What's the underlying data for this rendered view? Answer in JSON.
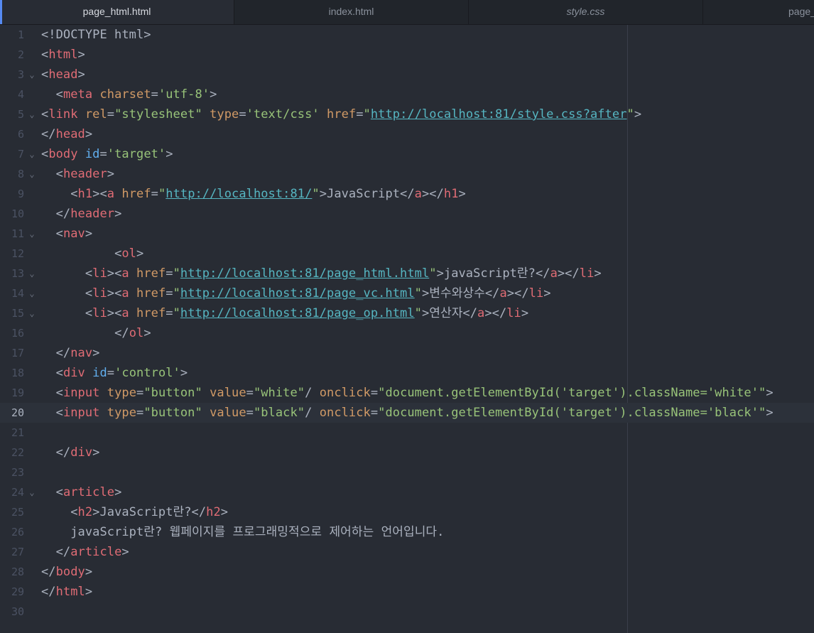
{
  "tabs": [
    {
      "label": "page_html.html",
      "active": true
    },
    {
      "label": "index.html",
      "active": false
    },
    {
      "label": "style.css",
      "active": false
    },
    {
      "label": "page_",
      "active": false
    }
  ],
  "cursor_line": 20,
  "lines": [
    {
      "n": "1",
      "fold": false,
      "tokens": [
        [
          "p",
          "<!DOCTYPE html>"
        ]
      ]
    },
    {
      "n": "2",
      "fold": false,
      "tokens": [
        [
          "p",
          "<"
        ],
        [
          "t",
          "html"
        ],
        [
          "p",
          ">"
        ]
      ]
    },
    {
      "n": "3",
      "fold": true,
      "tokens": [
        [
          "p",
          "<"
        ],
        [
          "t",
          "head"
        ],
        [
          "p",
          ">"
        ]
      ]
    },
    {
      "n": "4",
      "fold": false,
      "tokens": [
        [
          "x",
          "  "
        ],
        [
          "p",
          "<"
        ],
        [
          "t",
          "meta"
        ],
        [
          "x",
          " "
        ],
        [
          "a",
          "charset"
        ],
        [
          "p",
          "="
        ],
        [
          "s",
          "'utf-8'"
        ],
        [
          "p",
          ">"
        ]
      ]
    },
    {
      "n": "5",
      "fold": true,
      "tokens": [
        [
          "p",
          "<"
        ],
        [
          "t",
          "link"
        ],
        [
          "x",
          " "
        ],
        [
          "a",
          "rel"
        ],
        [
          "p",
          "="
        ],
        [
          "s",
          "\"stylesheet\""
        ],
        [
          "x",
          " "
        ],
        [
          "a",
          "type"
        ],
        [
          "p",
          "="
        ],
        [
          "s",
          "'text/css'"
        ],
        [
          "x",
          " "
        ],
        [
          "a",
          "href"
        ],
        [
          "p",
          "="
        ],
        [
          "s",
          "\""
        ],
        [
          "u",
          "http://localhost:81/style.css?after"
        ],
        [
          "s",
          "\""
        ],
        [
          "p",
          ">"
        ]
      ]
    },
    {
      "n": "6",
      "fold": false,
      "tokens": [
        [
          "p",
          "</"
        ],
        [
          "t",
          "head"
        ],
        [
          "p",
          ">"
        ]
      ]
    },
    {
      "n": "7",
      "fold": true,
      "tokens": [
        [
          "p",
          "<"
        ],
        [
          "t",
          "body"
        ],
        [
          "x",
          " "
        ],
        [
          "i",
          "id"
        ],
        [
          "p",
          "="
        ],
        [
          "s",
          "'target'"
        ],
        [
          "p",
          ">"
        ]
      ]
    },
    {
      "n": "8",
      "fold": true,
      "tokens": [
        [
          "x",
          "  "
        ],
        [
          "p",
          "<"
        ],
        [
          "t",
          "header"
        ],
        [
          "p",
          ">"
        ]
      ]
    },
    {
      "n": "9",
      "fold": false,
      "tokens": [
        [
          "x",
          "    "
        ],
        [
          "p",
          "<"
        ],
        [
          "t",
          "h1"
        ],
        [
          "p",
          "><"
        ],
        [
          "t",
          "a"
        ],
        [
          "x",
          " "
        ],
        [
          "a",
          "href"
        ],
        [
          "p",
          "="
        ],
        [
          "s",
          "\""
        ],
        [
          "u",
          "http://localhost:81/"
        ],
        [
          "s",
          "\""
        ],
        [
          "p",
          ">JavaScript</"
        ],
        [
          "t",
          "a"
        ],
        [
          "p",
          "></"
        ],
        [
          "t",
          "h1"
        ],
        [
          "p",
          ">"
        ]
      ]
    },
    {
      "n": "10",
      "fold": false,
      "tokens": [
        [
          "x",
          "  "
        ],
        [
          "p",
          "</"
        ],
        [
          "t",
          "header"
        ],
        [
          "p",
          ">"
        ]
      ]
    },
    {
      "n": "11",
      "fold": true,
      "tokens": [
        [
          "x",
          "  "
        ],
        [
          "p",
          "<"
        ],
        [
          "t",
          "nav"
        ],
        [
          "p",
          ">"
        ]
      ]
    },
    {
      "n": "12",
      "fold": false,
      "tokens": [
        [
          "x",
          "          "
        ],
        [
          "p",
          "<"
        ],
        [
          "t",
          "ol"
        ],
        [
          "p",
          ">"
        ]
      ]
    },
    {
      "n": "13",
      "fold": true,
      "tokens": [
        [
          "x",
          "      "
        ],
        [
          "p",
          "<"
        ],
        [
          "t",
          "li"
        ],
        [
          "p",
          "><"
        ],
        [
          "t",
          "a"
        ],
        [
          "x",
          " "
        ],
        [
          "a",
          "href"
        ],
        [
          "p",
          "="
        ],
        [
          "s",
          "\""
        ],
        [
          "u",
          "http://localhost:81/page_html.html"
        ],
        [
          "s",
          "\""
        ],
        [
          "p",
          ">javaScript란?</"
        ],
        [
          "t",
          "a"
        ],
        [
          "p",
          "></"
        ],
        [
          "t",
          "li"
        ],
        [
          "p",
          ">"
        ]
      ]
    },
    {
      "n": "14",
      "fold": true,
      "tokens": [
        [
          "x",
          "      "
        ],
        [
          "p",
          "<"
        ],
        [
          "t",
          "li"
        ],
        [
          "p",
          "><"
        ],
        [
          "t",
          "a"
        ],
        [
          "x",
          " "
        ],
        [
          "a",
          "href"
        ],
        [
          "p",
          "="
        ],
        [
          "s",
          "\""
        ],
        [
          "u",
          "http://localhost:81/page_vc.html"
        ],
        [
          "s",
          "\""
        ],
        [
          "p",
          ">변수와상수</"
        ],
        [
          "t",
          "a"
        ],
        [
          "p",
          "></"
        ],
        [
          "t",
          "li"
        ],
        [
          "p",
          ">"
        ]
      ]
    },
    {
      "n": "15",
      "fold": true,
      "tokens": [
        [
          "x",
          "      "
        ],
        [
          "p",
          "<"
        ],
        [
          "t",
          "li"
        ],
        [
          "p",
          "><"
        ],
        [
          "t",
          "a"
        ],
        [
          "x",
          " "
        ],
        [
          "a",
          "href"
        ],
        [
          "p",
          "="
        ],
        [
          "s",
          "\""
        ],
        [
          "u",
          "http://localhost:81/page_op.html"
        ],
        [
          "s",
          "\""
        ],
        [
          "p",
          ">연산자</"
        ],
        [
          "t",
          "a"
        ],
        [
          "p",
          "></"
        ],
        [
          "t",
          "li"
        ],
        [
          "p",
          ">"
        ]
      ]
    },
    {
      "n": "16",
      "fold": false,
      "tokens": [
        [
          "x",
          "          "
        ],
        [
          "p",
          "</"
        ],
        [
          "t",
          "ol"
        ],
        [
          "p",
          ">"
        ]
      ]
    },
    {
      "n": "17",
      "fold": false,
      "tokens": [
        [
          "x",
          "  "
        ],
        [
          "p",
          "</"
        ],
        [
          "t",
          "nav"
        ],
        [
          "p",
          ">"
        ]
      ]
    },
    {
      "n": "18",
      "fold": false,
      "tokens": [
        [
          "x",
          "  "
        ],
        [
          "p",
          "<"
        ],
        [
          "t",
          "div"
        ],
        [
          "x",
          " "
        ],
        [
          "i",
          "id"
        ],
        [
          "p",
          "="
        ],
        [
          "s",
          "'control'"
        ],
        [
          "p",
          ">"
        ]
      ]
    },
    {
      "n": "19",
      "fold": false,
      "tokens": [
        [
          "x",
          "  "
        ],
        [
          "p",
          "<"
        ],
        [
          "t",
          "input"
        ],
        [
          "x",
          " "
        ],
        [
          "a",
          "type"
        ],
        [
          "p",
          "="
        ],
        [
          "s",
          "\"button\""
        ],
        [
          "x",
          " "
        ],
        [
          "a",
          "value"
        ],
        [
          "p",
          "="
        ],
        [
          "s",
          "\"white\""
        ],
        [
          "p",
          "/ "
        ],
        [
          "a",
          "onclick"
        ],
        [
          "p",
          "="
        ],
        [
          "s",
          "\"document.getElementById('target').className='white'\""
        ],
        [
          "p",
          ">"
        ]
      ]
    },
    {
      "n": "20",
      "fold": false,
      "tokens": [
        [
          "x",
          "  "
        ],
        [
          "p",
          "<"
        ],
        [
          "t",
          "input"
        ],
        [
          "x",
          " "
        ],
        [
          "a",
          "type"
        ],
        [
          "p",
          "="
        ],
        [
          "s",
          "\"button\""
        ],
        [
          "x",
          " "
        ],
        [
          "a",
          "value"
        ],
        [
          "p",
          "="
        ],
        [
          "s",
          "\"black\""
        ],
        [
          "p",
          "/ "
        ],
        [
          "a",
          "onclick"
        ],
        [
          "p",
          "="
        ],
        [
          "s",
          "\"document.getElementById('target').className='black'\""
        ],
        [
          "p",
          ">"
        ]
      ]
    },
    {
      "n": "21",
      "fold": false,
      "tokens": []
    },
    {
      "n": "22",
      "fold": false,
      "tokens": [
        [
          "x",
          "  "
        ],
        [
          "p",
          "</"
        ],
        [
          "t",
          "div"
        ],
        [
          "p",
          ">"
        ]
      ]
    },
    {
      "n": "23",
      "fold": false,
      "tokens": []
    },
    {
      "n": "24",
      "fold": true,
      "tokens": [
        [
          "x",
          "  "
        ],
        [
          "p",
          "<"
        ],
        [
          "t",
          "article"
        ],
        [
          "p",
          ">"
        ]
      ]
    },
    {
      "n": "25",
      "fold": false,
      "tokens": [
        [
          "x",
          "    "
        ],
        [
          "p",
          "<"
        ],
        [
          "t",
          "h2"
        ],
        [
          "p",
          ">JavaScript란?</"
        ],
        [
          "t",
          "h2"
        ],
        [
          "p",
          ">"
        ]
      ]
    },
    {
      "n": "26",
      "fold": false,
      "tokens": [
        [
          "x",
          "    "
        ],
        [
          "p",
          "javaScript란? 웹페이지를 프로그래밍적으로 제어하는 언어입니다."
        ]
      ]
    },
    {
      "n": "27",
      "fold": false,
      "tokens": [
        [
          "x",
          "  "
        ],
        [
          "p",
          "</"
        ],
        [
          "t",
          "article"
        ],
        [
          "p",
          ">"
        ]
      ]
    },
    {
      "n": "28",
      "fold": false,
      "tokens": [
        [
          "p",
          "</"
        ],
        [
          "t",
          "body"
        ],
        [
          "p",
          ">"
        ]
      ]
    },
    {
      "n": "29",
      "fold": false,
      "tokens": [
        [
          "p",
          "</"
        ],
        [
          "t",
          "html"
        ],
        [
          "p",
          ">"
        ]
      ]
    },
    {
      "n": "30",
      "fold": false,
      "tokens": []
    }
  ]
}
